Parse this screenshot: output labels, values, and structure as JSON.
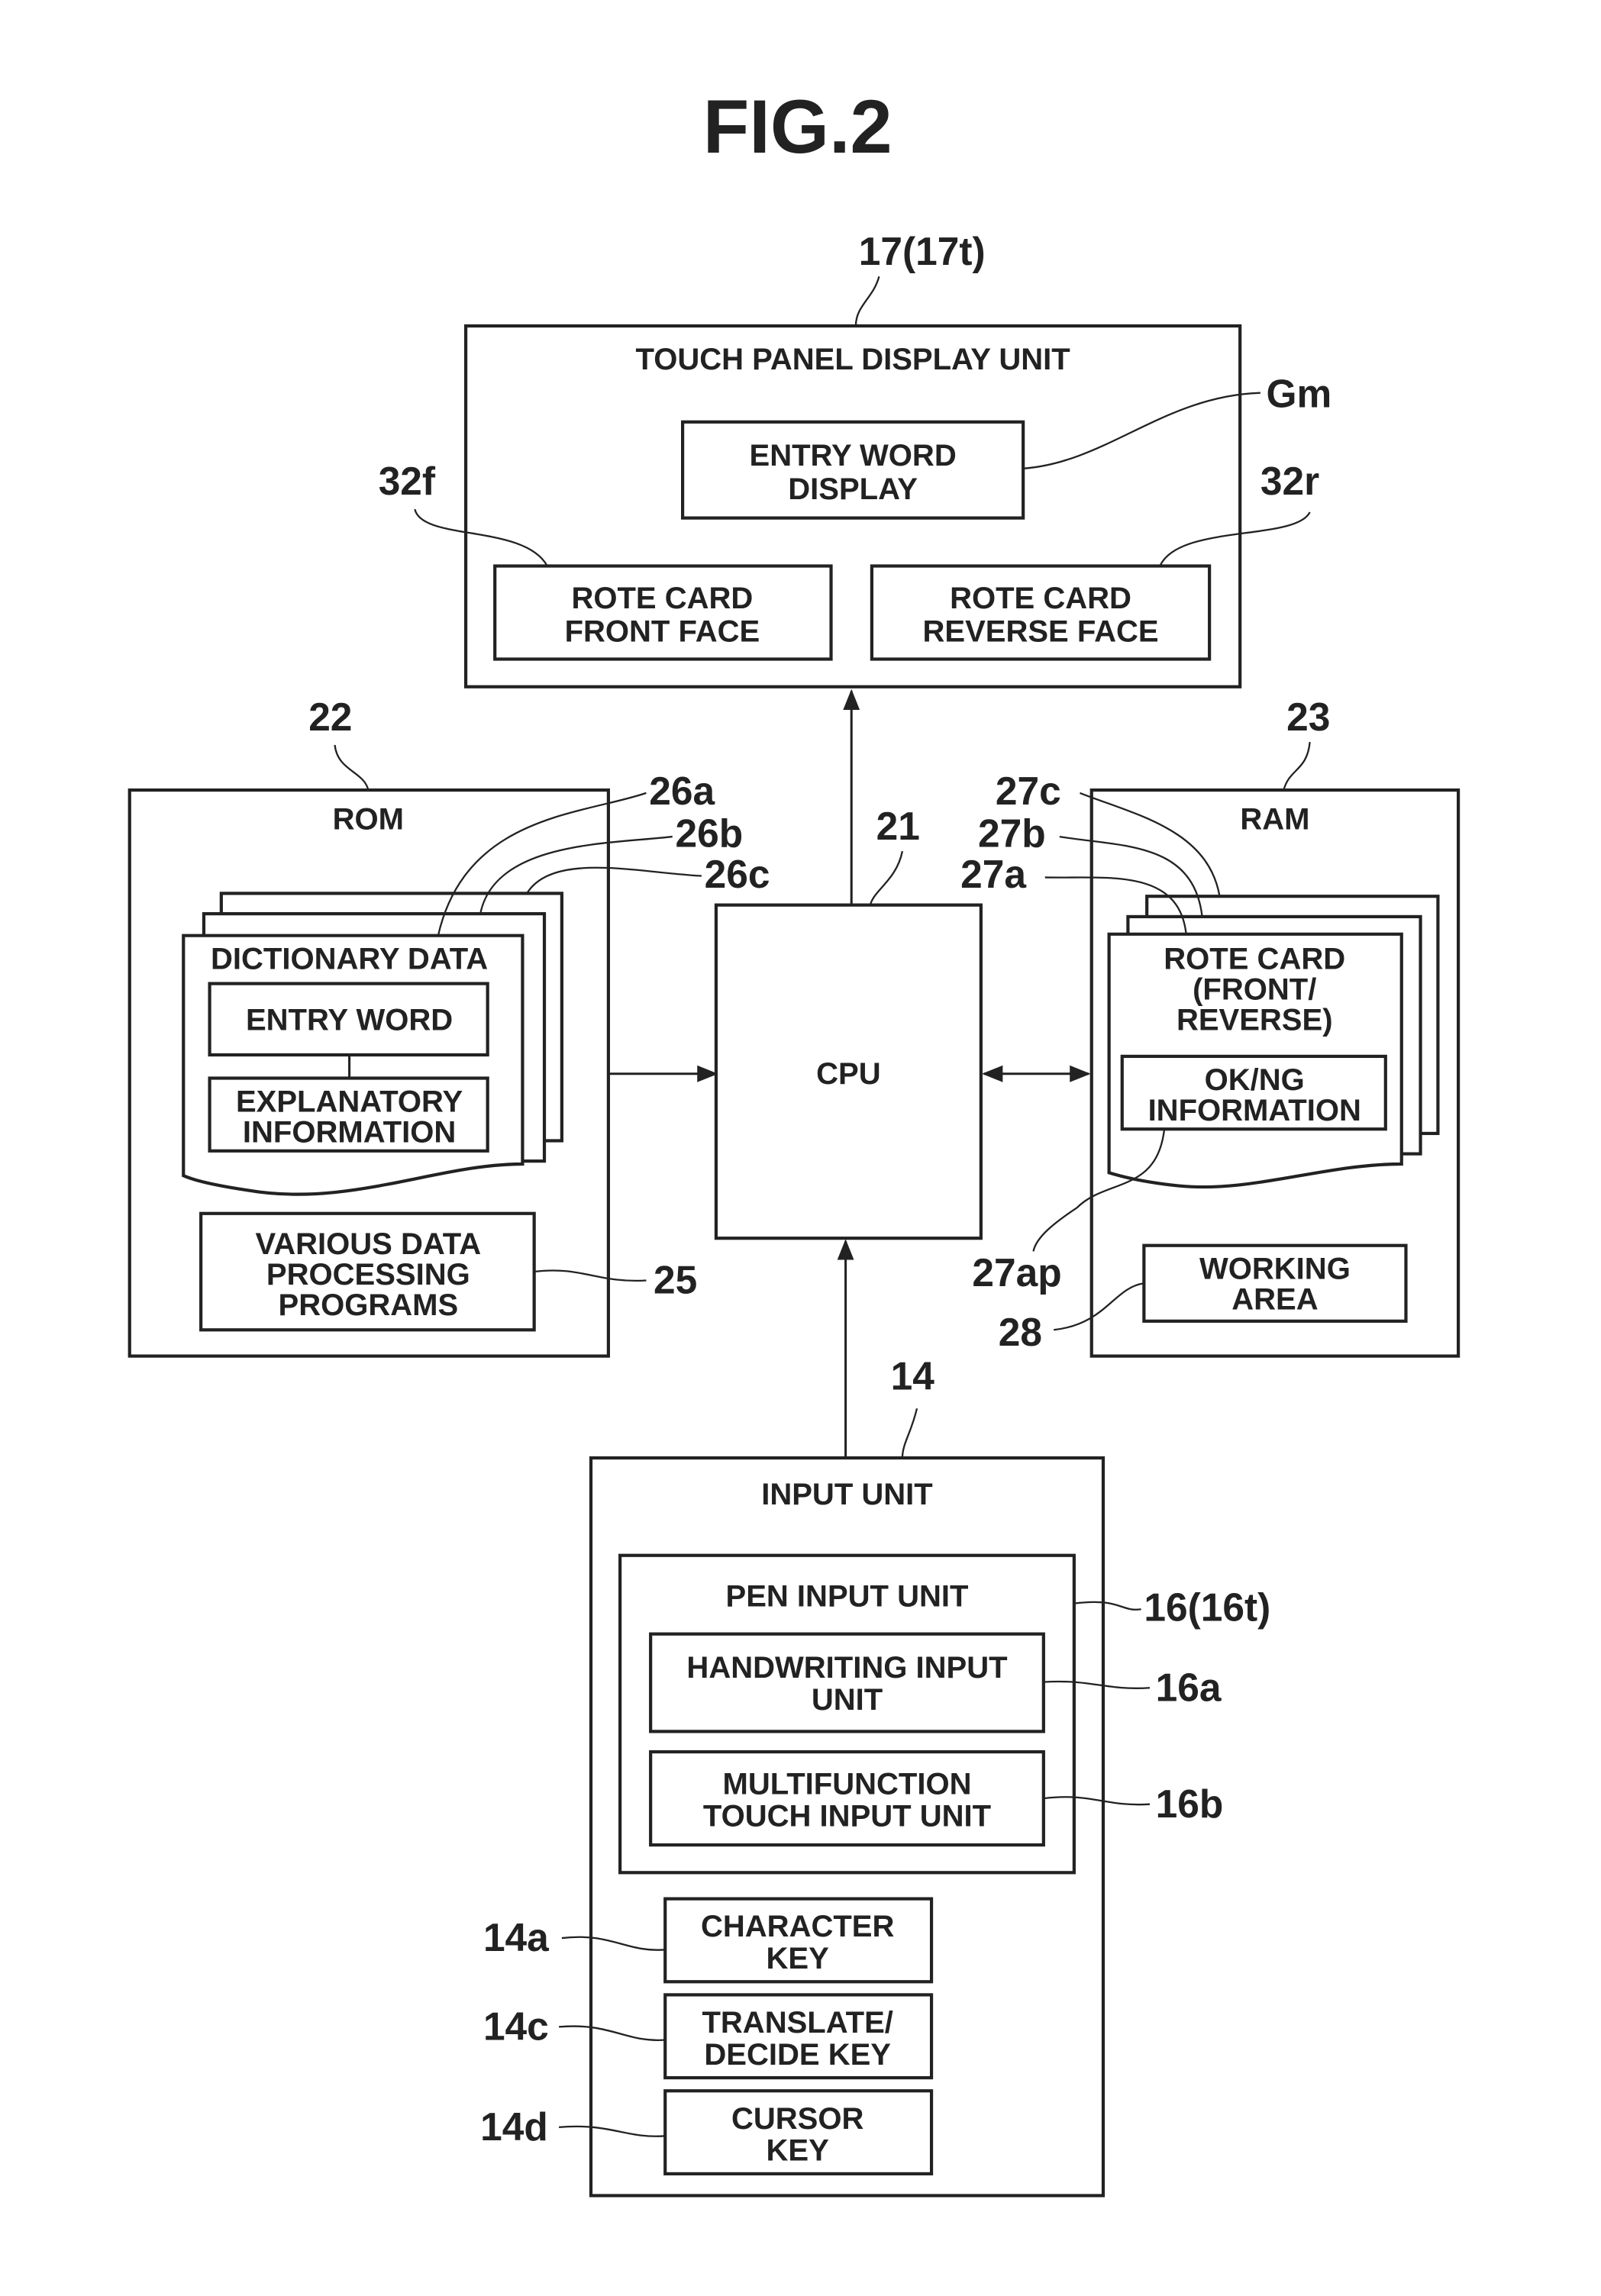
{
  "figure_title": "FIG.2",
  "touch_panel": {
    "ref": "17(17t)",
    "label": "TOUCH PANEL DISPLAY UNIT",
    "entry_word_display": {
      "ref": "Gm",
      "line1": "ENTRY WORD",
      "line2": "DISPLAY"
    },
    "front_face": {
      "ref": "32f",
      "line1": "ROTE CARD",
      "line2": "FRONT FACE"
    },
    "reverse_face": {
      "ref": "32r",
      "line1": "ROTE CARD",
      "line2": "REVERSE FACE"
    }
  },
  "rom": {
    "ref": "22",
    "label": "ROM",
    "dictionary": {
      "refs": [
        "26a",
        "26b",
        "26c"
      ],
      "label": "DICTIONARY DATA",
      "entry_word": "ENTRY WORD",
      "expl1": "EXPLANATORY",
      "expl2": "INFORMATION"
    },
    "programs": {
      "ref": "25",
      "line1": "VARIOUS DATA",
      "line2": "PROCESSING",
      "line3": "PROGRAMS"
    }
  },
  "cpu": {
    "ref": "21",
    "label": "CPU"
  },
  "ram": {
    "ref": "23",
    "label": "RAM",
    "rote_card": {
      "refs": [
        "27a",
        "27b",
        "27c"
      ],
      "line1": "ROTE CARD",
      "line2": "(FRONT/",
      "line3": "REVERSE)"
    },
    "okng": {
      "ref": "27ap",
      "line1": "OK/NG",
      "line2": "INFORMATION"
    },
    "working": {
      "ref": "28",
      "line1": "WORKING",
      "line2": "AREA"
    }
  },
  "input_unit": {
    "ref": "14",
    "label": "INPUT UNIT",
    "pen": {
      "ref": "16(16t)",
      "label": "PEN INPUT UNIT"
    },
    "handwriting": {
      "ref": "16a",
      "line1": "HANDWRITING INPUT",
      "line2": "UNIT"
    },
    "multifunction": {
      "ref": "16b",
      "line1": "MULTIFUNCTION",
      "line2": "TOUCH INPUT UNIT"
    },
    "character_key": {
      "ref": "14a",
      "line1": "CHARACTER",
      "line2": "KEY"
    },
    "translate_key": {
      "ref": "14c",
      "line1": "TRANSLATE/",
      "line2": "DECIDE KEY"
    },
    "cursor_key": {
      "ref": "14d",
      "line1": "CURSOR",
      "line2": "KEY"
    }
  }
}
